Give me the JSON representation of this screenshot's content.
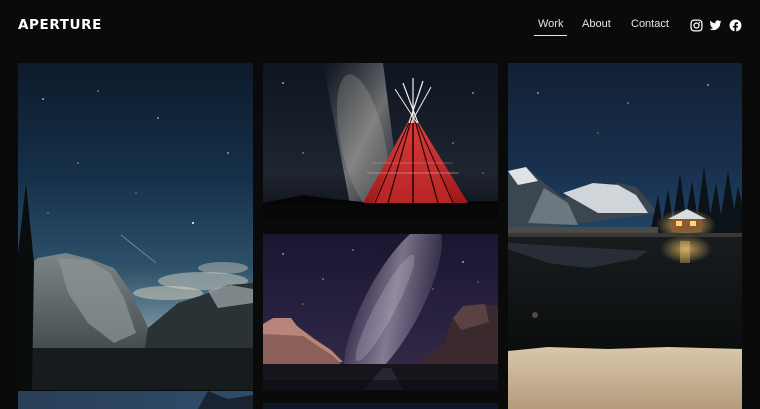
{
  "brand": {
    "name": "APERTURE"
  },
  "nav": {
    "items": [
      {
        "label": "Work",
        "active": true
      },
      {
        "label": "About",
        "active": false
      },
      {
        "label": "Contact",
        "active": false
      }
    ]
  },
  "social": {
    "icons": [
      "instagram-icon",
      "twitter-icon",
      "facebook-icon"
    ]
  },
  "gallery": {
    "photos": [
      {
        "subject": "yosemite-night-sky"
      },
      {
        "subject": "teepee-milky-way"
      },
      {
        "subject": "lake-cabin-night"
      },
      {
        "subject": "desert-milky-way"
      },
      {
        "subject": "night-sky-partial"
      },
      {
        "subject": "night-partial"
      }
    ]
  },
  "colors": {
    "background": "#0a0a0a",
    "text": "#e6e6e6",
    "accent": "#ffffff"
  }
}
